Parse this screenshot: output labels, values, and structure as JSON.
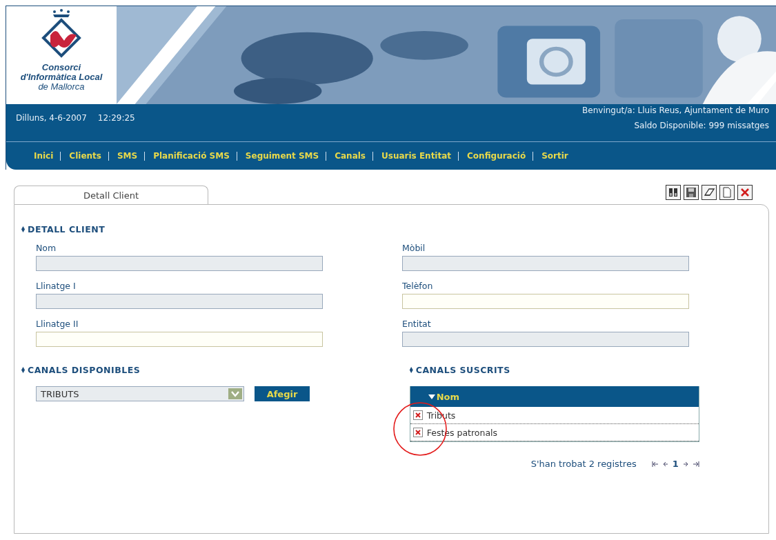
{
  "header": {
    "logo_lines": [
      "Consorci",
      "d'Informàtica Local",
      "de Mallorca"
    ],
    "date": "Dilluns, 4-6-2007",
    "time": "12:29:25",
    "welcome": "Benvingut/a: Lluis Reus, Ajuntament de Muro",
    "balance": "Saldo Disponible: 999 missatges"
  },
  "nav": [
    "Inici",
    "Clients",
    "SMS",
    "Planificació SMS",
    "Seguiment SMS",
    "Canals",
    "Usuaris Entitat",
    "Configuració",
    "Sortir"
  ],
  "tabs": [
    {
      "label": "Detall Client",
      "selected": true
    }
  ],
  "toolbar": [
    {
      "kind": "search"
    },
    {
      "kind": "save"
    },
    {
      "kind": "erase"
    },
    {
      "kind": "new"
    },
    {
      "kind": "delete"
    }
  ],
  "detail": {
    "title": "DETALL CLIENT",
    "left_fields": [
      {
        "label": "Nom",
        "disabled": true
      },
      {
        "label": "Llinatge I",
        "disabled": true
      },
      {
        "label": "Llinatge II",
        "disabled": false
      }
    ],
    "right_fields": [
      {
        "label": "Mòbil",
        "disabled": true
      },
      {
        "label": "Telèfon",
        "disabled": false
      },
      {
        "label": "Entitat",
        "disabled": true
      }
    ]
  },
  "available": {
    "title": "CANALS DISPONIBLES",
    "select_value": "TRIBUTS",
    "button": "Afegir"
  },
  "subscribed": {
    "title": "CANALS SUSCRITS",
    "column": "Nom",
    "rows": [
      "Tributs",
      "Festes patronals"
    ],
    "summary": "S'han trobat 2 registres",
    "page": "1"
  }
}
